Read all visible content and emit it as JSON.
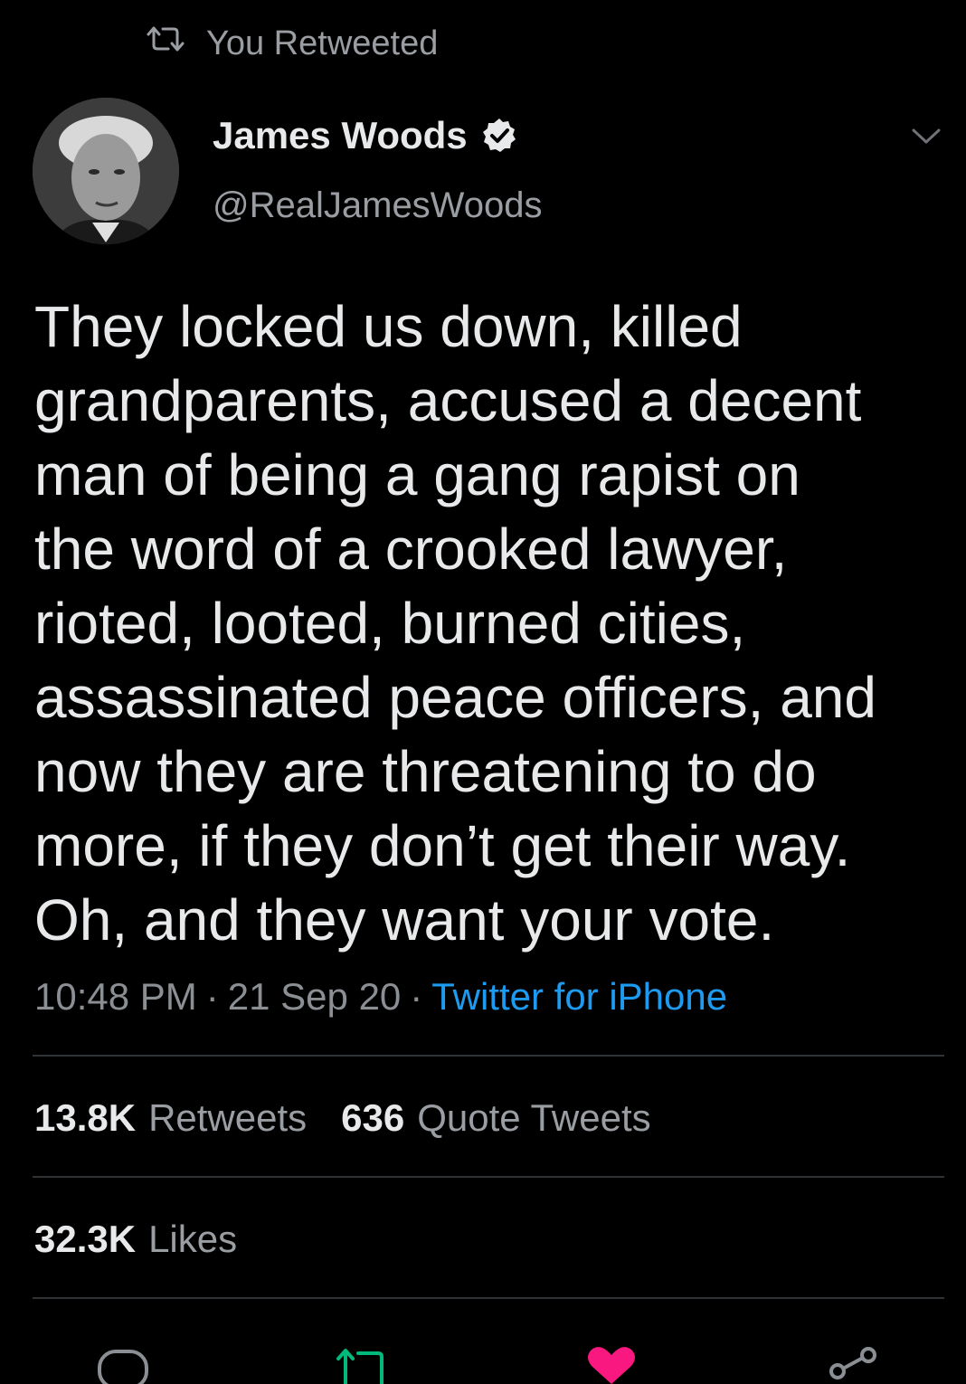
{
  "retweet_context": {
    "icon": "retweet-icon",
    "label": "You Retweeted"
  },
  "author": {
    "name": "James Woods",
    "handle": "@RealJamesWoods",
    "verified_icon": "verified-badge-icon"
  },
  "tweet": {
    "text": "They locked us down, killed\ngrandparents, accused a decent\nman of being a gang rapist on\nthe word of a crooked lawyer,\nrioted, looted, burned cities,\nassassinated peace officers, and\nnow they are threatening to do\nmore, if they don’t get their way.\nOh, and they want your vote.",
    "time": "10:48 PM",
    "separator": "·",
    "date": "21 Sep 20",
    "source": "Twitter for iPhone"
  },
  "stats": {
    "retweets_count": "13.8K",
    "retweets_label": "Retweets",
    "quotes_count": "636",
    "quotes_label": "Quote Tweets",
    "likes_count": "32.3K",
    "likes_label": "Likes"
  },
  "actions": [
    {
      "name": "reply",
      "icon": "reply-icon"
    },
    {
      "name": "retweet",
      "icon": "retweet-icon",
      "active": true,
      "color": "#00ba7c"
    },
    {
      "name": "like",
      "icon": "heart-icon",
      "active": true,
      "color": "#f91880"
    },
    {
      "name": "share",
      "icon": "share-icon"
    }
  ],
  "colors": {
    "background": "#000000",
    "primary_text": "#e7e9ea",
    "secondary_text": "#9a9ea3",
    "link": "#1d9bf0",
    "divider": "#2f3336"
  }
}
